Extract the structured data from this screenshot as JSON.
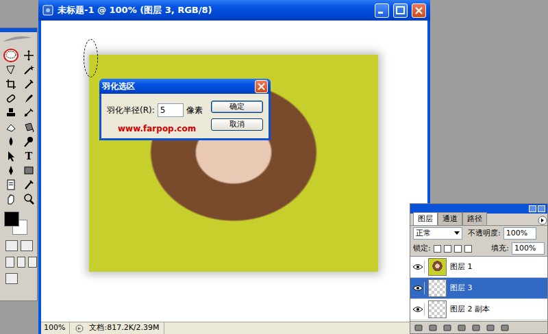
{
  "window": {
    "title": "未标题-1 @ 100% (图层 3, RGB/8)"
  },
  "toolbox": {
    "tools": [
      {
        "selected": true
      },
      {
        "selected": false
      },
      {
        "selected": false
      },
      {
        "selected": false
      },
      {
        "selected": false
      },
      {
        "selected": false
      },
      {
        "selected": false
      },
      {
        "selected": false
      },
      {
        "selected": false
      },
      {
        "selected": false
      },
      {
        "selected": false
      },
      {
        "selected": false
      },
      {
        "selected": false
      },
      {
        "selected": false
      },
      {
        "selected": false
      },
      {
        "label": "T",
        "selected": false
      },
      {
        "selected": false
      },
      {
        "selected": false
      },
      {
        "selected": false
      },
      {
        "selected": false
      },
      {
        "selected": false
      },
      {
        "selected": false
      }
    ]
  },
  "dialog": {
    "title": "羽化选区",
    "field_label": "羽化半径(R):",
    "value": "5",
    "unit": "像素",
    "link": "www.farpop.com",
    "buttons": [
      "确定",
      "取消"
    ]
  },
  "status_bar": {
    "zoom": "100%",
    "document": "文档:817.2K/2.39M"
  },
  "layers_panel": {
    "tabs": [
      {
        "label": "图层",
        "selected": true
      },
      {
        "label": "通道",
        "selected": false
      },
      {
        "label": "路径",
        "selected": false
      }
    ],
    "blend_mode": "正常",
    "opacity_label": "不透明度:",
    "opacity": "100%",
    "lock_label": "锁定:",
    "fill_label": "填充:",
    "fill": "100%",
    "layers": [
      {
        "name": "图层 1",
        "visible": true,
        "selected": false,
        "kind": "photo"
      },
      {
        "name": "图层 3",
        "visible": true,
        "selected": true,
        "kind": "empty"
      },
      {
        "name": "图层 2 副本",
        "visible": true,
        "selected": false,
        "kind": "empty"
      }
    ]
  }
}
